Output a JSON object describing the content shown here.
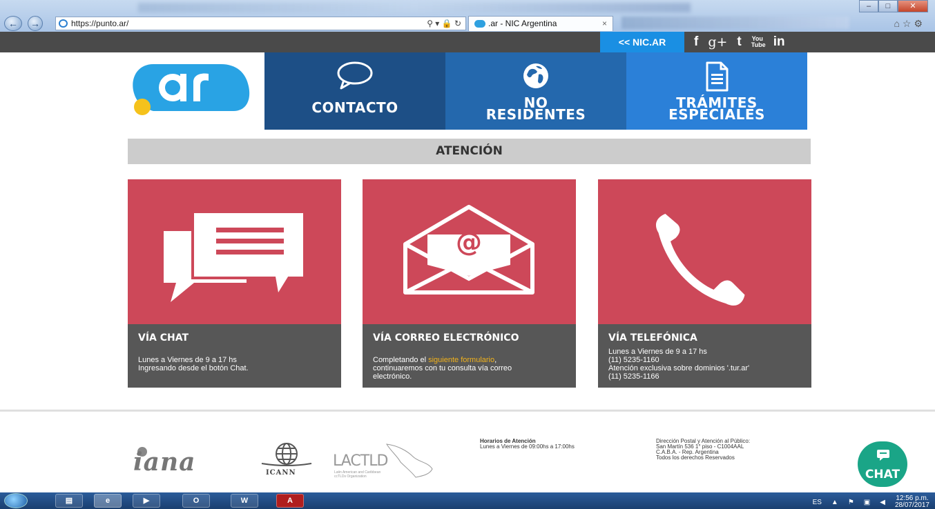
{
  "browser": {
    "url": "https://punto.ar/",
    "tab_title": ".ar - NIC Argentina",
    "tab_close": "×"
  },
  "topbar": {
    "nic_link": "<< NIC.AR",
    "social": [
      "f",
      "g+",
      "t",
      "You Tube",
      "in"
    ]
  },
  "nav": {
    "contacto": "CONTACTO",
    "no_residentes_1": "NO",
    "no_residentes_2": "RESIDENTES",
    "tramites_1": "TRÁMITES",
    "tramites_2": "ESPECIALES"
  },
  "section_title": "ATENCIÓN",
  "cards": {
    "chat": {
      "title": "VÍA CHAT",
      "line1": "Lunes a Viernes de 9 a 17 hs",
      "line2": "Ingresando desde el botón Chat."
    },
    "email": {
      "title": "VÍA CORREO ELECTRÓNICO",
      "pre": "Completando el ",
      "link": "siguiente formulario",
      "post": ",",
      "line2": "continuaremos con tu consulta vía correo",
      "line3": "electrónico."
    },
    "phone": {
      "title": "VÍA TELEFÓNICA",
      "line1": "Lunes a Viernes de 9 a 17 hs",
      "line2": "(11) 5235-1160",
      "line3": "Atención exclusiva sobre dominios '.tur.ar'",
      "line4": "(11) 5235-1166"
    }
  },
  "footer": {
    "iana": "iana",
    "icann": "ICANN",
    "lactld": "LACTLD",
    "lactld_sub1": "Latin American and Caribbean",
    "lactld_sub2": "ccTLDs Organization",
    "hours_title": "Horarios de Atención",
    "hours": "Lunes a Viernes de 09:00hs a 17:00hs",
    "addr1": "Dirección Postal y Atención al Público:",
    "addr2": "San Martín 536 1° piso - C1004AAL",
    "addr3": "C.A.B.A. - Rep. Argentina",
    "addr4": "Todos los derechos Reservados",
    "chat_button": "CHAT"
  },
  "taskbar": {
    "lang": "ES",
    "time": "12:56 p.m.",
    "date": "28/07/2017"
  },
  "colors": {
    "card_red": "#cd4859",
    "card_dark": "#575757",
    "tile1": "#1d4f86",
    "tile2": "#2468ad",
    "tile3": "#2b80d8",
    "chat_green": "#1aa587",
    "link_orange": "#f3b31b"
  }
}
